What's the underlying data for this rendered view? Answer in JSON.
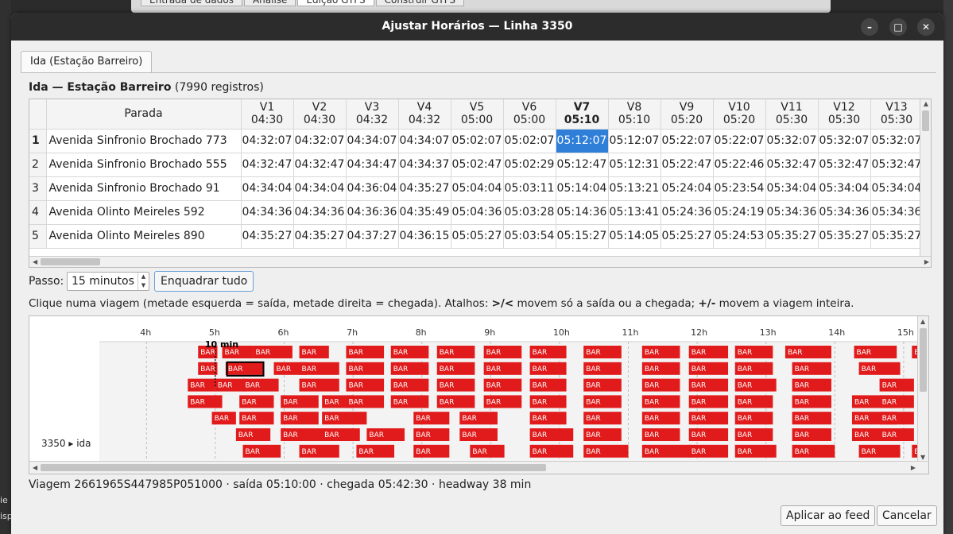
{
  "background": {
    "tabs": [
      "Entrada de dados",
      "Análise",
      "Edição GTFS",
      "Construir GTFS"
    ],
    "left_fragments": [
      "ie",
      "isp"
    ]
  },
  "window": {
    "title": "Ajustar Horários — Linha 3350",
    "controls": {
      "minimize": "–",
      "maximize": "□",
      "close": "✕"
    }
  },
  "tab": {
    "label": "Ida (Estação Barreiro)"
  },
  "table": {
    "title": "Ida — Estação Barreiro",
    "count": "(7990 registros)",
    "stop_header": "Parada",
    "selected_trip": 6,
    "selected_row": 0,
    "trips": [
      {
        "id": "V1",
        "time": "04:30"
      },
      {
        "id": "V2",
        "time": "04:30"
      },
      {
        "id": "V3",
        "time": "04:32"
      },
      {
        "id": "V4",
        "time": "04:32"
      },
      {
        "id": "V5",
        "time": "05:00"
      },
      {
        "id": "V6",
        "time": "05:00"
      },
      {
        "id": "V7",
        "time": "05:10"
      },
      {
        "id": "V8",
        "time": "05:10"
      },
      {
        "id": "V9",
        "time": "05:20"
      },
      {
        "id": "V10",
        "time": "05:20"
      },
      {
        "id": "V11",
        "time": "05:30"
      },
      {
        "id": "V12",
        "time": "05:30"
      },
      {
        "id": "V13",
        "time": "05:30"
      }
    ],
    "rows": [
      {
        "n": "1",
        "stop": "Avenida Sinfronio Brochado 773",
        "times": [
          "04:32:07",
          "04:32:07",
          "04:34:07",
          "04:34:07",
          "05:02:07",
          "05:02:07",
          "05:12:07",
          "05:12:07",
          "05:22:07",
          "05:22:07",
          "05:32:07",
          "05:32:07",
          "05:32:07"
        ]
      },
      {
        "n": "2",
        "stop": "Avenida Sinfronio Brochado 555",
        "times": [
          "04:32:47",
          "04:32:47",
          "04:34:47",
          "04:34:37",
          "05:02:47",
          "05:02:29",
          "05:12:47",
          "05:12:31",
          "05:22:47",
          "05:22:46",
          "05:32:47",
          "05:32:47",
          "05:32:47"
        ]
      },
      {
        "n": "3",
        "stop": "Avenida Sinfronio Brochado 91",
        "times": [
          "04:34:04",
          "04:34:04",
          "04:36:04",
          "04:35:27",
          "05:04:04",
          "05:03:11",
          "05:14:04",
          "05:13:21",
          "05:24:04",
          "05:23:54",
          "05:34:04",
          "05:34:04",
          "05:34:04"
        ]
      },
      {
        "n": "4",
        "stop": "Avenida Olinto Meireles 592",
        "times": [
          "04:34:36",
          "04:34:36",
          "04:36:36",
          "04:35:49",
          "05:04:36",
          "05:03:28",
          "05:14:36",
          "05:13:41",
          "05:24:36",
          "05:24:19",
          "05:34:36",
          "05:34:36",
          "05:34:36"
        ]
      },
      {
        "n": "5",
        "stop": "Avenida Olinto Meireles 890",
        "times": [
          "04:35:27",
          "04:35:27",
          "04:37:27",
          "04:36:15",
          "05:05:27",
          "05:03:54",
          "05:15:27",
          "05:14:05",
          "05:25:27",
          "05:24:53",
          "05:35:27",
          "05:35:27",
          "05:35:27"
        ]
      }
    ]
  },
  "controls": {
    "step_label": "Passo:",
    "step_value": "15 minutos",
    "fit_button": "Enquadrar tudo",
    "help_parts": [
      "Clique numa viagem (metade esquerda = saída, metade direita = chegada). Atalhos: ",
      ">/<",
      " movem só a saída ou a chegada; ",
      "+/-",
      " movem a viagem inteira."
    ]
  },
  "gantt": {
    "hours": [
      "4h",
      "5h",
      "6h",
      "7h",
      "8h",
      "9h",
      "10h",
      "11h",
      "12h",
      "13h",
      "14h",
      "15h"
    ],
    "row_label": "3350 ▸ ida",
    "bar_text": "BAR",
    "marker_label": "10 min",
    "bar_color": "#e11b1b",
    "lanes": [
      [
        [
          4.75,
          5.03
        ],
        [
          5.1,
          5.55
        ],
        [
          5.55,
          6.12
        ],
        [
          6.22,
          6.65
        ],
        [
          6.9,
          7.45
        ],
        [
          7.55,
          8.1
        ],
        [
          8.22,
          8.77
        ],
        [
          8.9,
          9.45
        ],
        [
          9.57,
          10.1
        ],
        [
          10.35,
          10.9
        ],
        [
          11.2,
          11.75
        ],
        [
          11.88,
          12.45
        ],
        [
          12.55,
          13.1
        ],
        [
          13.28,
          13.95
        ],
        [
          14.28,
          14.9
        ],
        [
          15.12,
          15.65
        ]
      ],
      [
        [
          4.75,
          5.03
        ],
        [
          5.15,
          5.7
        ],
        [
          5.85,
          6.33
        ],
        [
          6.22,
          6.8
        ],
        [
          6.9,
          7.45
        ],
        [
          7.55,
          8.1
        ],
        [
          8.22,
          8.77
        ],
        [
          8.9,
          9.45
        ],
        [
          9.57,
          10.1
        ],
        [
          10.35,
          10.9
        ],
        [
          11.2,
          11.75
        ],
        [
          11.88,
          12.45
        ],
        [
          12.55,
          13.1
        ],
        [
          13.38,
          13.95
        ],
        [
          14.35,
          14.95
        ],
        [
          15.3,
          15.65
        ]
      ],
      [
        [
          4.6,
          5.0
        ],
        [
          5.0,
          5.45
        ],
        [
          5.4,
          5.92
        ],
        [
          6.22,
          6.8
        ],
        [
          6.9,
          7.45
        ],
        [
          7.55,
          8.1
        ],
        [
          8.22,
          8.77
        ],
        [
          8.9,
          9.45
        ],
        [
          9.57,
          10.1
        ],
        [
          10.35,
          10.9
        ],
        [
          11.2,
          11.75
        ],
        [
          11.88,
          12.45
        ],
        [
          12.55,
          13.15
        ],
        [
          13.38,
          13.95
        ],
        [
          14.65,
          15.15
        ],
        [
          15.3,
          15.65
        ]
      ],
      [
        [
          4.6,
          5.1
        ],
        [
          5.35,
          5.85
        ],
        [
          5.95,
          6.5
        ],
        [
          6.55,
          7.0
        ],
        [
          6.9,
          7.45
        ],
        [
          7.55,
          8.1
        ],
        [
          8.22,
          8.77
        ],
        [
          8.9,
          9.45
        ],
        [
          9.57,
          10.1
        ],
        [
          10.35,
          10.9
        ],
        [
          11.2,
          11.75
        ],
        [
          11.88,
          12.45
        ],
        [
          12.55,
          13.1
        ],
        [
          13.38,
          13.95
        ],
        [
          14.25,
          14.9
        ],
        [
          14.65,
          15.15
        ],
        [
          15.3,
          15.65
        ]
      ],
      [
        [
          4.95,
          5.3
        ],
        [
          5.35,
          5.85
        ],
        [
          5.95,
          6.5
        ],
        [
          6.55,
          7.2
        ],
        [
          7.88,
          8.4
        ],
        [
          8.55,
          9.1
        ],
        [
          9.57,
          10.1
        ],
        [
          10.35,
          10.9
        ],
        [
          11.2,
          11.75
        ],
        [
          11.88,
          12.45
        ],
        [
          12.55,
          13.1
        ],
        [
          13.38,
          13.95
        ],
        [
          14.25,
          14.9
        ],
        [
          14.65,
          15.15
        ],
        [
          15.3,
          15.65
        ]
      ],
      [
        [
          5.3,
          5.8
        ],
        [
          5.95,
          6.6
        ],
        [
          6.55,
          7.1
        ],
        [
          7.2,
          7.75
        ],
        [
          7.88,
          8.4
        ],
        [
          8.55,
          9.1
        ],
        [
          9.57,
          10.2
        ],
        [
          10.35,
          10.9
        ],
        [
          11.2,
          11.75
        ],
        [
          11.88,
          12.45
        ],
        [
          12.55,
          13.1
        ],
        [
          13.38,
          13.95
        ],
        [
          14.25,
          14.9
        ],
        [
          14.65,
          15.15
        ],
        [
          15.3,
          15.65
        ]
      ],
      [
        [
          5.4,
          5.95
        ],
        [
          6.22,
          6.8
        ],
        [
          7.05,
          7.6
        ],
        [
          7.88,
          8.4
        ],
        [
          8.7,
          9.2
        ],
        [
          9.57,
          10.2
        ],
        [
          10.35,
          11.0
        ],
        [
          11.2,
          11.9
        ],
        [
          11.88,
          12.45
        ],
        [
          12.55,
          13.15
        ],
        [
          13.38,
          14.0
        ],
        [
          14.35,
          14.95
        ],
        [
          15.12,
          15.65
        ]
      ]
    ]
  },
  "status": "Viagem 2661965S447985P051000 · saída 05:10:00 · chegada 05:42:30 · headway 38 min",
  "buttons": {
    "apply": "Aplicar ao feed",
    "cancel": "Cancelar"
  }
}
